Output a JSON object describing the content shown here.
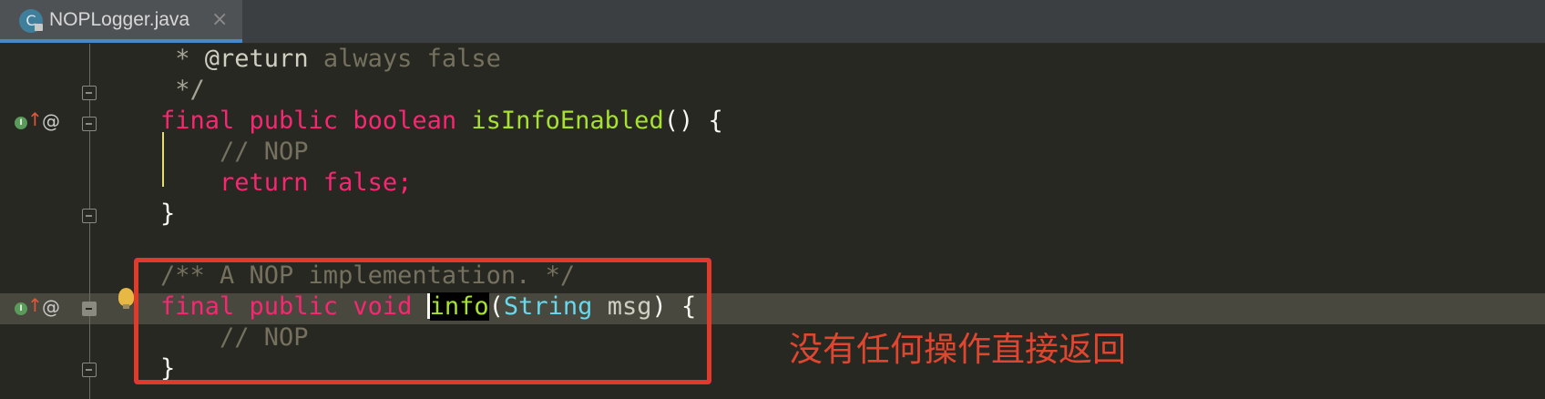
{
  "tab": {
    "label": "NOPLogger.java",
    "icon_letter": "C",
    "close_symbol": "×"
  },
  "code": {
    "line1": {
      "star": " * ",
      "tag": "@return",
      "text": " always false"
    },
    "line2": {
      "text": " */"
    },
    "line3": {
      "kw": "final public boolean ",
      "fn": "isInfoEnabled",
      "rest": "() {"
    },
    "line4": {
      "comment": "    // NOP"
    },
    "line5": {
      "kw": "    return false;"
    },
    "line6": {
      "text": "}"
    },
    "line7": {
      "comment": "/** A NOP implementation. */"
    },
    "line8": {
      "kw": "final public void ",
      "fn": "info",
      "paren": "(",
      "ty": "String",
      "param": " msg",
      "rest": ") {"
    },
    "line9": {
      "comment": "    // NOP"
    },
    "line10": {
      "text": "}"
    }
  },
  "gutter": {
    "implements_letter": "I",
    "arrow": "↑",
    "at": "@"
  },
  "annotation": {
    "text": "没有任何操作直接返回",
    "color": "#e0462f"
  },
  "colors": {
    "keyword": "#f92672",
    "function": "#a6e22e",
    "type": "#66d9ef",
    "comment": "#75715e",
    "background": "#272822",
    "highlight_box": "#e03a2b"
  }
}
